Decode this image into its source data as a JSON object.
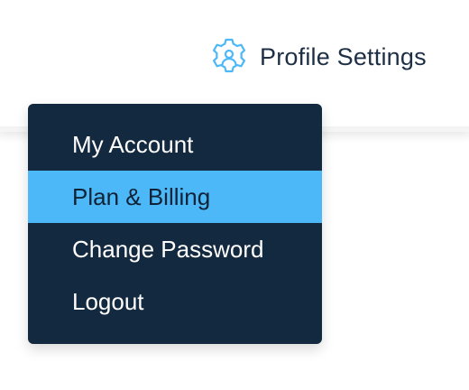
{
  "header": {
    "profile_settings_label": "Profile Settings",
    "profile_settings_icon": "gear-user-icon",
    "icon_color": "#4db8f7"
  },
  "menu": {
    "items": [
      {
        "label": "My Account",
        "active": false
      },
      {
        "label": "Plan & Billing",
        "active": true
      },
      {
        "label": "Change Password",
        "active": false
      },
      {
        "label": "Logout",
        "active": false
      }
    ],
    "background_color": "#13293f",
    "active_color": "#4db8f7"
  }
}
